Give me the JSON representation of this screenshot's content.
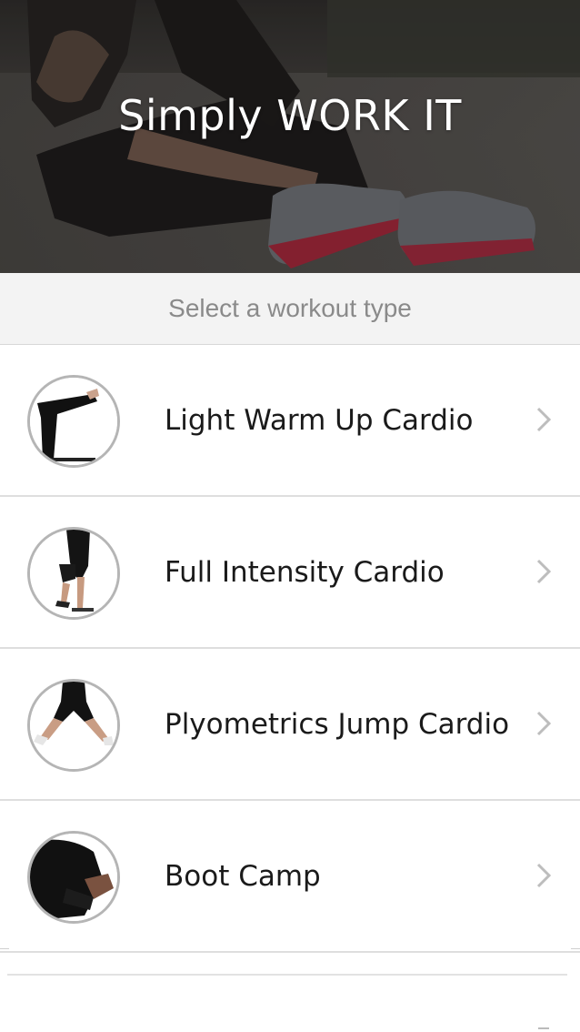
{
  "app": {
    "title": "Simply WORK IT"
  },
  "header": {
    "subtitle": "Select a workout type"
  },
  "workouts": [
    {
      "label": "Light Warm Up Cardio",
      "thumbnail_icon": "warm-up-leg-stretch-icon"
    },
    {
      "label": "Full Intensity Cardio",
      "thumbnail_icon": "lunge-icon"
    },
    {
      "label": "Plyometrics Jump Cardio",
      "thumbnail_icon": "jump-squat-icon"
    },
    {
      "label": "Boot Camp",
      "thumbnail_icon": "pushup-icon"
    }
  ],
  "icons": {
    "chevron": "chevron-right-icon"
  },
  "colors": {
    "subheader_bg": "#f3f3f3",
    "subheader_text": "#8a8a8a",
    "chevron": "#bdbdbd",
    "divider": "#dedede"
  }
}
